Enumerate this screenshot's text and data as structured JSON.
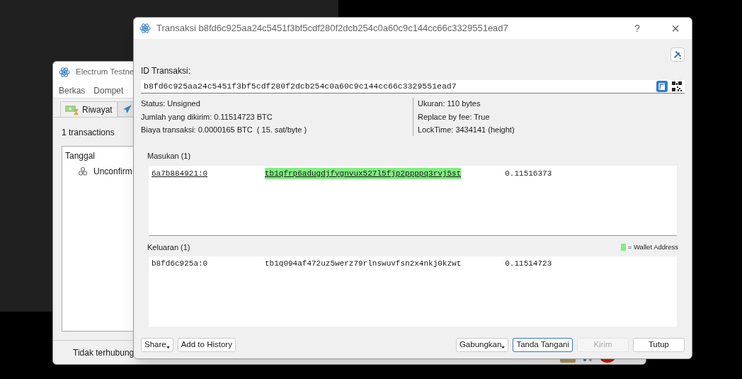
{
  "main_window": {
    "title": "Electrum Testne",
    "menu": [
      "Berkas",
      "Dompet"
    ],
    "tabs": [
      {
        "label": "Riwayat",
        "selected": true
      },
      {
        "selected": false
      }
    ],
    "count": "1 transactions",
    "columns": [
      "Tanggal"
    ],
    "rows": [
      {
        "label": "Unconfirm"
      }
    ],
    "status_bar": "Tidak terhubung"
  },
  "dialog": {
    "title": "Transaksi b8fd6c925aa24c5451f3bf5cdf280f2dcb254c0a60c9c144cc66c3329551ead7",
    "help": "?",
    "close": "×",
    "id_label": "ID Transaksi:",
    "id_value": "b8fd6c925aa24c5451f3bf5cdf280f2dcb254c0a60c9c144cc66c3329551ead7",
    "info_left": [
      "Status: Unsigned",
      "Jumlah yang dikirim: 0.11514723 BTC",
      "Biaya transaksi: 0.0000165 BTC  ( 15. sat/byte )"
    ],
    "info_right": [
      "Ukuran: 110 bytes",
      "Replace by fee: True",
      "LockTime: 3434141 (height)"
    ],
    "inputs_label": "Masukan (1)",
    "inputs": [
      {
        "prev": "6a7b884921:0",
        "address": "tb1qfrp6adugdjfygnvux527l5fjp2ppppq3rvj5st",
        "amount": "0.11516373",
        "highlighted": true
      }
    ],
    "outputs_label": "Keluaran (1)",
    "legend": "= Wallet Address",
    "outputs": [
      {
        "prev": "b8fd6c925a:0",
        "address": "tb1q094af472uz5werz79rlnswuvfsn2x4nkj0kzwt",
        "amount": "0.11514723",
        "highlighted": false
      }
    ],
    "buttons_left": [
      {
        "label": "Share",
        "dropdown": true,
        "default": false,
        "disabled": false
      },
      {
        "label": "Add to History",
        "dropdown": false,
        "default": false,
        "disabled": false
      }
    ],
    "buttons_right": [
      {
        "label": "Gabungkan",
        "dropdown": true,
        "default": false,
        "disabled": false
      },
      {
        "label": "Tanda Tangani",
        "dropdown": false,
        "default": true,
        "disabled": false
      },
      {
        "label": "Kirim",
        "dropdown": false,
        "default": false,
        "disabled": true
      },
      {
        "label": "Tutup",
        "dropdown": false,
        "default": false,
        "disabled": false
      }
    ]
  }
}
